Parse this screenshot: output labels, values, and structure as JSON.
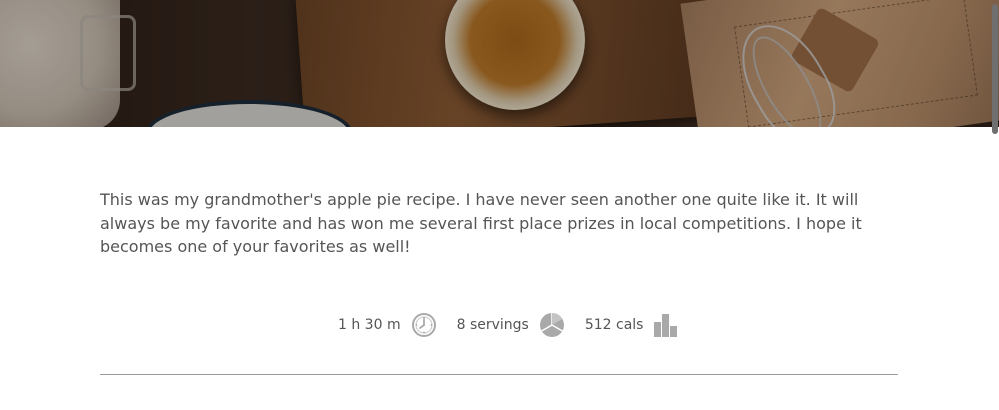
{
  "hero": {
    "image": "apple-pie-ingredients-photo"
  },
  "description": "This was my grandmother's apple pie recipe. I have never seen another one quite like it. It will always be my favorite and has won me several first place prizes in local competitions. I hope it becomes one of your favorites as well!",
  "stats": {
    "time": {
      "label": "1 h 30 m",
      "icon": "clock-icon"
    },
    "servings": {
      "label": "8 servings",
      "icon": "pie-icon"
    },
    "calories": {
      "label": "512 cals",
      "icon": "bar-chart-icon"
    }
  },
  "colors": {
    "text": "#555555",
    "icon": "#a9a9a9",
    "divider": "#9a9a9a"
  }
}
